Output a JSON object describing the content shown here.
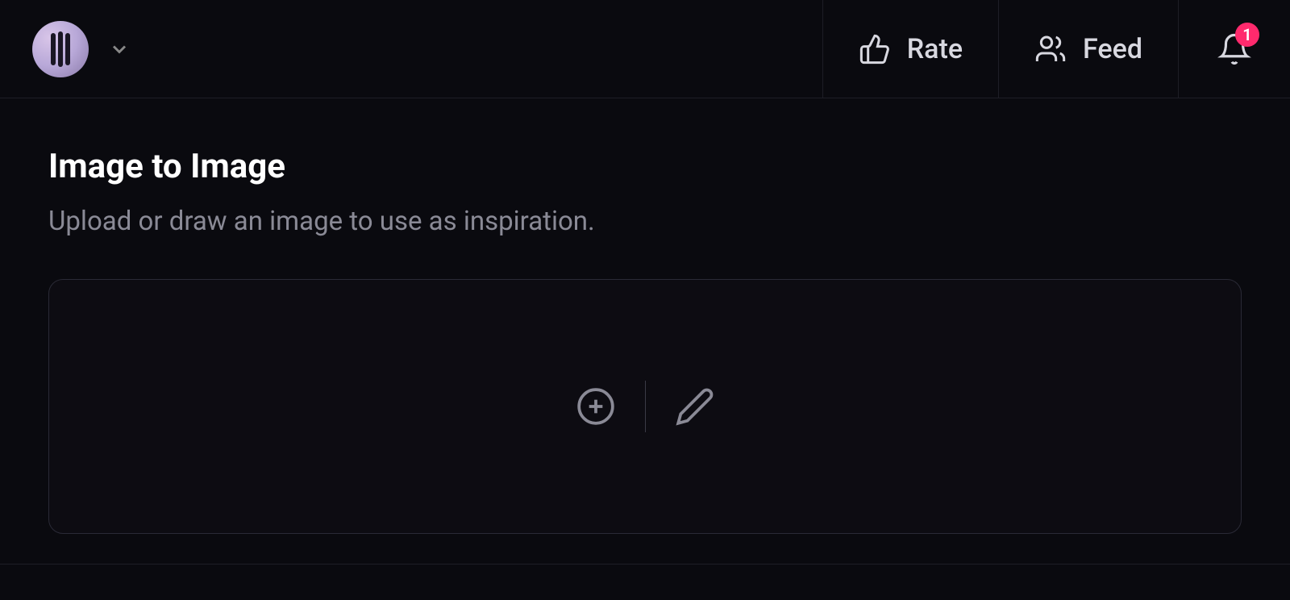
{
  "header": {
    "rate_label": "Rate",
    "feed_label": "Feed",
    "notification_count": "1"
  },
  "main": {
    "title": "Image to Image",
    "subtitle": "Upload or draw an image to use as inspiration."
  }
}
